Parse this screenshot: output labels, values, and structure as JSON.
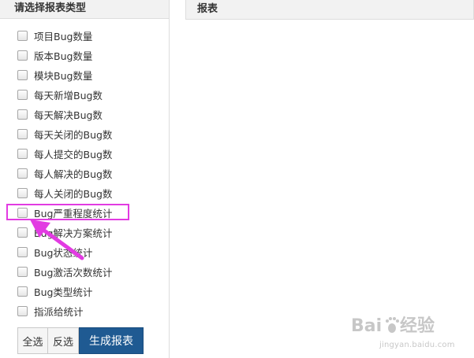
{
  "left_panel": {
    "title": "请选择报表类型",
    "items": [
      {
        "label": "项目Bug数量",
        "checked": false
      },
      {
        "label": "版本Bug数量",
        "checked": false
      },
      {
        "label": "模块Bug数量",
        "checked": false
      },
      {
        "label": "每天新增Bug数",
        "checked": false
      },
      {
        "label": "每天解决Bug数",
        "checked": false
      },
      {
        "label": "每天关闭的Bug数",
        "checked": false
      },
      {
        "label": "每人提交的Bug数",
        "checked": false
      },
      {
        "label": "每人解决的Bug数",
        "checked": false
      },
      {
        "label": "每人关闭的Bug数",
        "checked": false
      },
      {
        "label": "Bug严重程度统计",
        "checked": false,
        "highlighted": true
      },
      {
        "label": "Bug解决方案统计",
        "checked": false
      },
      {
        "label": "Bug状态统计",
        "checked": false
      },
      {
        "label": "Bug激活次数统计",
        "checked": false
      },
      {
        "label": "Bug类型统计",
        "checked": false
      },
      {
        "label": "指派给统计",
        "checked": false
      }
    ],
    "buttons": {
      "select_all": "全选",
      "invert": "反选",
      "generate": "生成报表"
    }
  },
  "right_panel": {
    "title": "报表"
  },
  "annotation": {
    "color": "#e23be2",
    "target": "Bug严重程度统计"
  },
  "watermark": {
    "brand": "Baidu经验",
    "domain": "jingyan.baidu.com"
  },
  "colors": {
    "header_bg": "#f2f2f2",
    "border": "#dddddd",
    "primary_button": "#1f5a92",
    "annotation": "#e23be2"
  }
}
